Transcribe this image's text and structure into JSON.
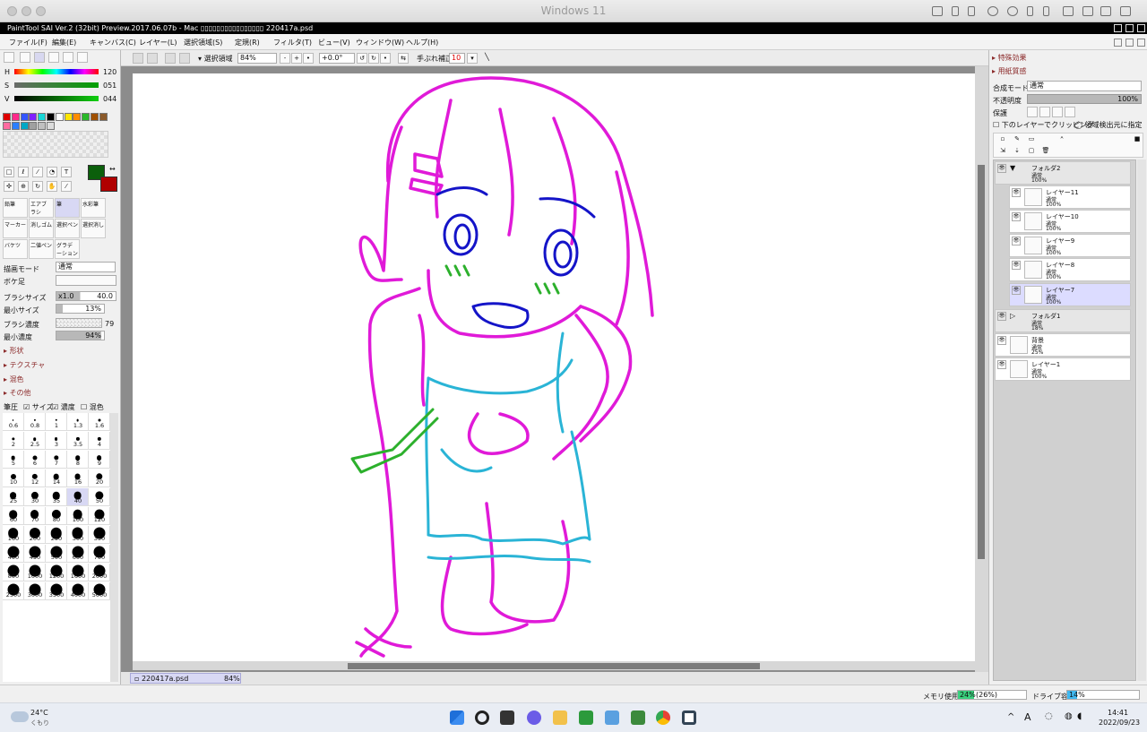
{
  "mac": {
    "title": "Windows 11"
  },
  "app": {
    "title": "PaintTool SAI Ver.2 (32bit) Preview.2017.06.07b - Mac ▯▯▯▯▯▯▯▯▯▯▯▯▯▯▯▯ 220417a.psd"
  },
  "menu": [
    "ファイル(F)",
    "編集(E)",
    "キャンバス(C)",
    "レイヤー(L)",
    "選択領域(S)",
    "定規(R)",
    "フィルタ(T)",
    "ビュー(V)",
    "ウィンドウ(W)",
    "ヘルプ(H)"
  ],
  "color_sliders": {
    "h_label": "H",
    "h_value": "120",
    "s_label": "S",
    "s_value": "051",
    "v_label": "V",
    "v_value": "044"
  },
  "palette_colors": [
    "#e00000",
    "#ff2a8a",
    "#3355ff",
    "#7f20ff",
    "#18d6d6",
    "#000000",
    "#ffffff",
    "#ffe600",
    "#ff8c00",
    "#2ab82a",
    "#a05000",
    "#8b5a2b",
    "#ff6aa0",
    "#2a7fff",
    "#00a8c6",
    "#a0a0a0",
    "#c0c0c0",
    "#dcdcdc"
  ],
  "colors": {
    "primary": "#0b5f0b",
    "secondary": "#b00000",
    "magenta": "#e01ad8",
    "cyan": "#2ab4d6",
    "blue": "#1414c8",
    "green": "#2cb02c"
  },
  "tools": {
    "brushes": [
      {
        "name": "鉛筆"
      },
      {
        "name": "エアブラシ"
      },
      {
        "name": "筆"
      },
      {
        "name": "水彩筆"
      },
      {
        "name": "マーカー"
      },
      {
        "name": "消しゴム"
      },
      {
        "name": "選択ペン"
      },
      {
        "name": "選択消し"
      },
      {
        "name": "バケツ"
      },
      {
        "name": "二値ペン"
      },
      {
        "name": "グラデーション"
      }
    ]
  },
  "brush_props": {
    "draw_mode_label": "描画モード",
    "draw_mode_value": "通常",
    "blur_label": "ボケ足",
    "size_label": "ブラシサイズ",
    "size_mult": "x1.0",
    "size_value": "40.0",
    "min_size_label": "最小サイズ",
    "min_size_value": "13%",
    "density_label": "ブラシ濃度",
    "density_value": "79",
    "min_density_label": "最小濃度",
    "min_density_value": "94%"
  },
  "sections": [
    "形状",
    "テクスチャ",
    "混色",
    "その他"
  ],
  "pressure": {
    "label": "筆圧",
    "size": "サイズ",
    "density": "濃度",
    "color": "混色"
  },
  "brush_sizes": [
    "0.6",
    "0.8",
    "1",
    "1.3",
    "1.6",
    "2",
    "2.5",
    "3",
    "3.5",
    "4",
    "5",
    "6",
    "7",
    "8",
    "9",
    "10",
    "12",
    "14",
    "16",
    "20",
    "25",
    "30",
    "35",
    "40",
    "50",
    "60",
    "70",
    "80",
    "100",
    "120",
    "160",
    "200",
    "250",
    "300",
    "350",
    "400",
    "450",
    "500",
    "600",
    "700",
    "800",
    "1000",
    "1200",
    "1600",
    "2000",
    "2500",
    "3000",
    "3500",
    "4000",
    "5000"
  ],
  "toolbar": {
    "selection": "選択領域",
    "zoom": "84%",
    "angle": "+0.0°",
    "stab_label": "手ぶれ補正",
    "stab_value": "10"
  },
  "file_tab": {
    "name": "220417a.psd",
    "zoom": "84%"
  },
  "right": {
    "special_fx": "特殊効果",
    "paper_texture": "用紙質感",
    "blend_label": "合成モード",
    "blend_value": "通常",
    "opacity_label": "不透明度",
    "opacity_value": "100%",
    "protect_label": "保護",
    "clip_label": "下のレイヤーでクリッピング",
    "detect_label": "領域検出元に指定"
  },
  "layers": [
    {
      "name": "フォルダ2",
      "mode": "通常",
      "opacity": "100%",
      "folder": true
    },
    {
      "name": "レイヤー11",
      "mode": "通常",
      "opacity": "100%"
    },
    {
      "name": "レイヤー10",
      "mode": "通常",
      "opacity": "100%"
    },
    {
      "name": "レイヤー9",
      "mode": "通常",
      "opacity": "100%"
    },
    {
      "name": "レイヤー8",
      "mode": "通常",
      "opacity": "100%"
    },
    {
      "name": "レイヤー7",
      "mode": "通常",
      "opacity": "100%",
      "selected": true
    },
    {
      "name": "フォルダ1",
      "mode": "通常",
      "opacity": "18%",
      "folder": true
    },
    {
      "name": "背景",
      "mode": "通常",
      "opacity": "25%"
    },
    {
      "name": "レイヤー1",
      "mode": "通常",
      "opacity": "100%"
    }
  ],
  "status": {
    "mem_label": "メモリ使用量",
    "mem_value": "24%",
    "mem_paren": "(26%)",
    "drive_label": "ドライブ容量",
    "drive_value": "14%"
  },
  "taskbar": {
    "weather_temp": "24°C",
    "weather_desc": "くもり",
    "time": "14:41",
    "date": "2022/09/23",
    "ime": "A"
  }
}
